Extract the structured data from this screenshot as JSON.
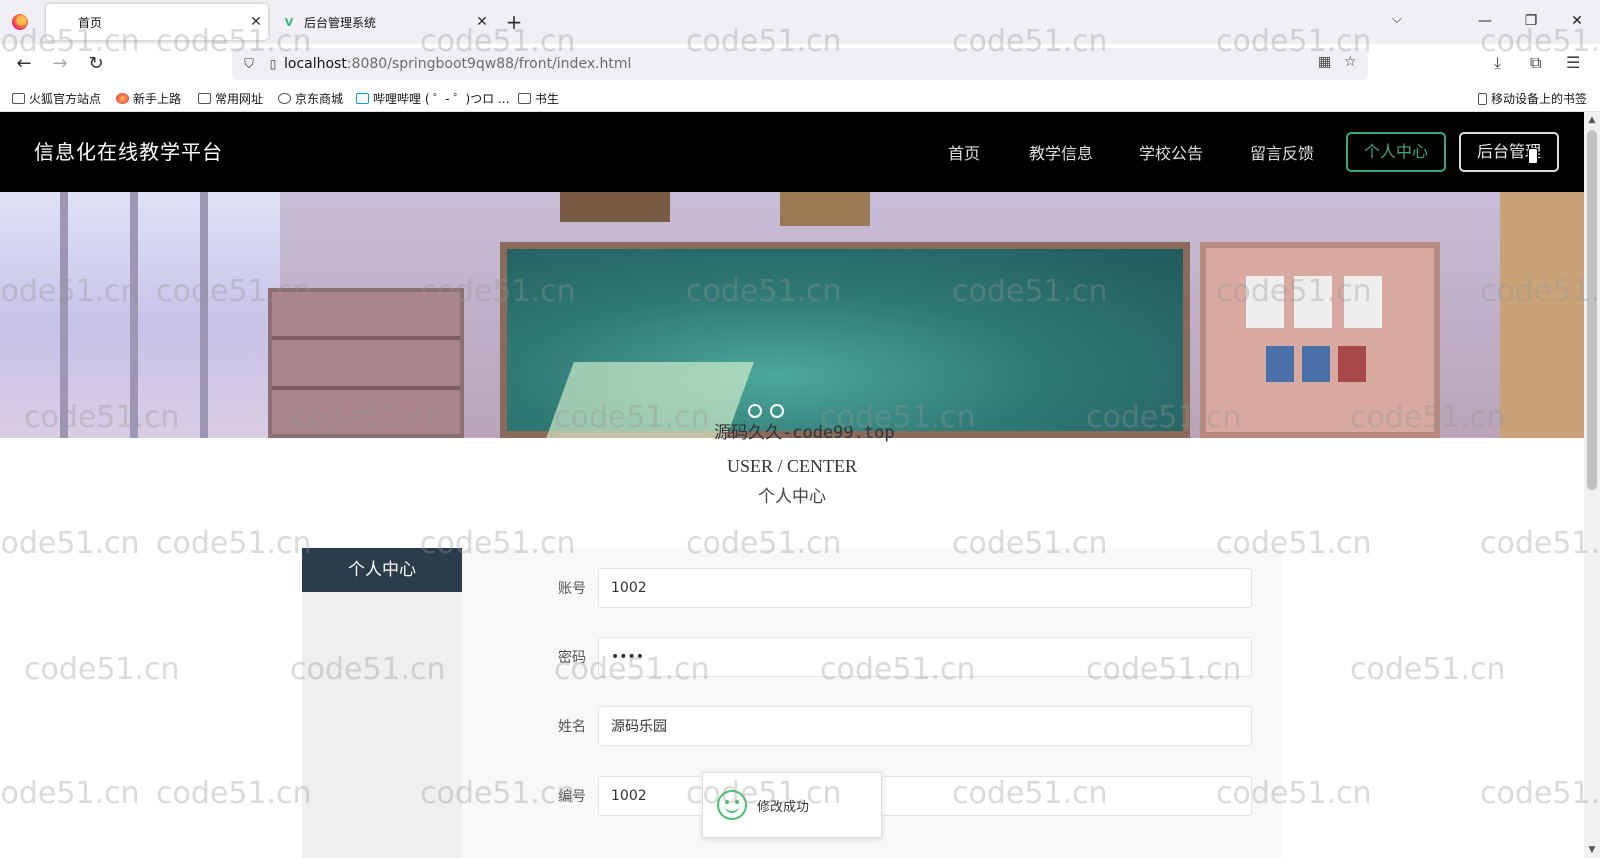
{
  "browser": {
    "tabs": [
      {
        "label": "首页",
        "active": true
      },
      {
        "label": "后台管理系统",
        "active": false
      }
    ],
    "new_tab": "+",
    "tab_list": "⌵",
    "window_controls": {
      "minimize": "—",
      "restore": "❐",
      "close": "✕"
    },
    "url_host": "localhost",
    "url_path": ":8080/springboot9qw88/front/index.html",
    "bookmarks": [
      "火狐官方站点",
      "新手上路",
      "常用网址",
      "京东商城",
      "哔哩哔哩 ( ゜- ゜)つロ ...",
      "书生"
    ],
    "mobile_bookmarks": "移动设备上的书签"
  },
  "site": {
    "title": "信息化在线教学平台",
    "nav": [
      "首页",
      "教学信息",
      "学校公告",
      "留言反馈"
    ],
    "btn_center": "个人中心",
    "btn_admin": "后台管理",
    "accent": "#3aa58a"
  },
  "overlay_text": "源码久久-code99.top",
  "section": {
    "en": "USER / CENTER",
    "cn": "个人中心"
  },
  "side_menu": {
    "active": "个人中心"
  },
  "form": {
    "fields": [
      {
        "label": "账号",
        "value": "1002"
      },
      {
        "label": "密码",
        "value": "••••"
      },
      {
        "label": "姓名",
        "value": "源码乐园"
      },
      {
        "label": "编号",
        "value": "1002"
      }
    ]
  },
  "toast": {
    "message": "修改成功"
  },
  "watermark": "code51.cn"
}
